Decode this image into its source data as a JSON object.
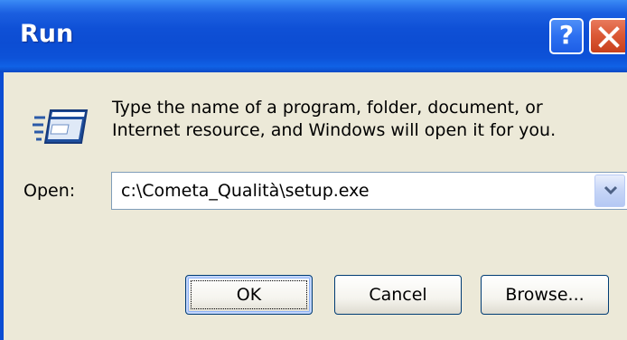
{
  "window": {
    "title": "Run",
    "help_label": "?",
    "icons": {
      "help": "help-icon",
      "close": "close-icon",
      "run": "run-program-icon",
      "dropdown": "chevron-down-icon"
    }
  },
  "content": {
    "description_line1": "Type the name of a program, folder, document, or",
    "description_line2": "Internet resource, and Windows will open it for you.",
    "open_label": "Open:",
    "open_value": "c:\\Cometa_Qualità\\setup.exe"
  },
  "buttons": {
    "ok": "OK",
    "cancel": "Cancel",
    "browse": "Browse..."
  },
  "colors": {
    "titlebar": "#0c4dd3",
    "close": "#dc5a37",
    "dialog_bg": "#ece9d8"
  }
}
